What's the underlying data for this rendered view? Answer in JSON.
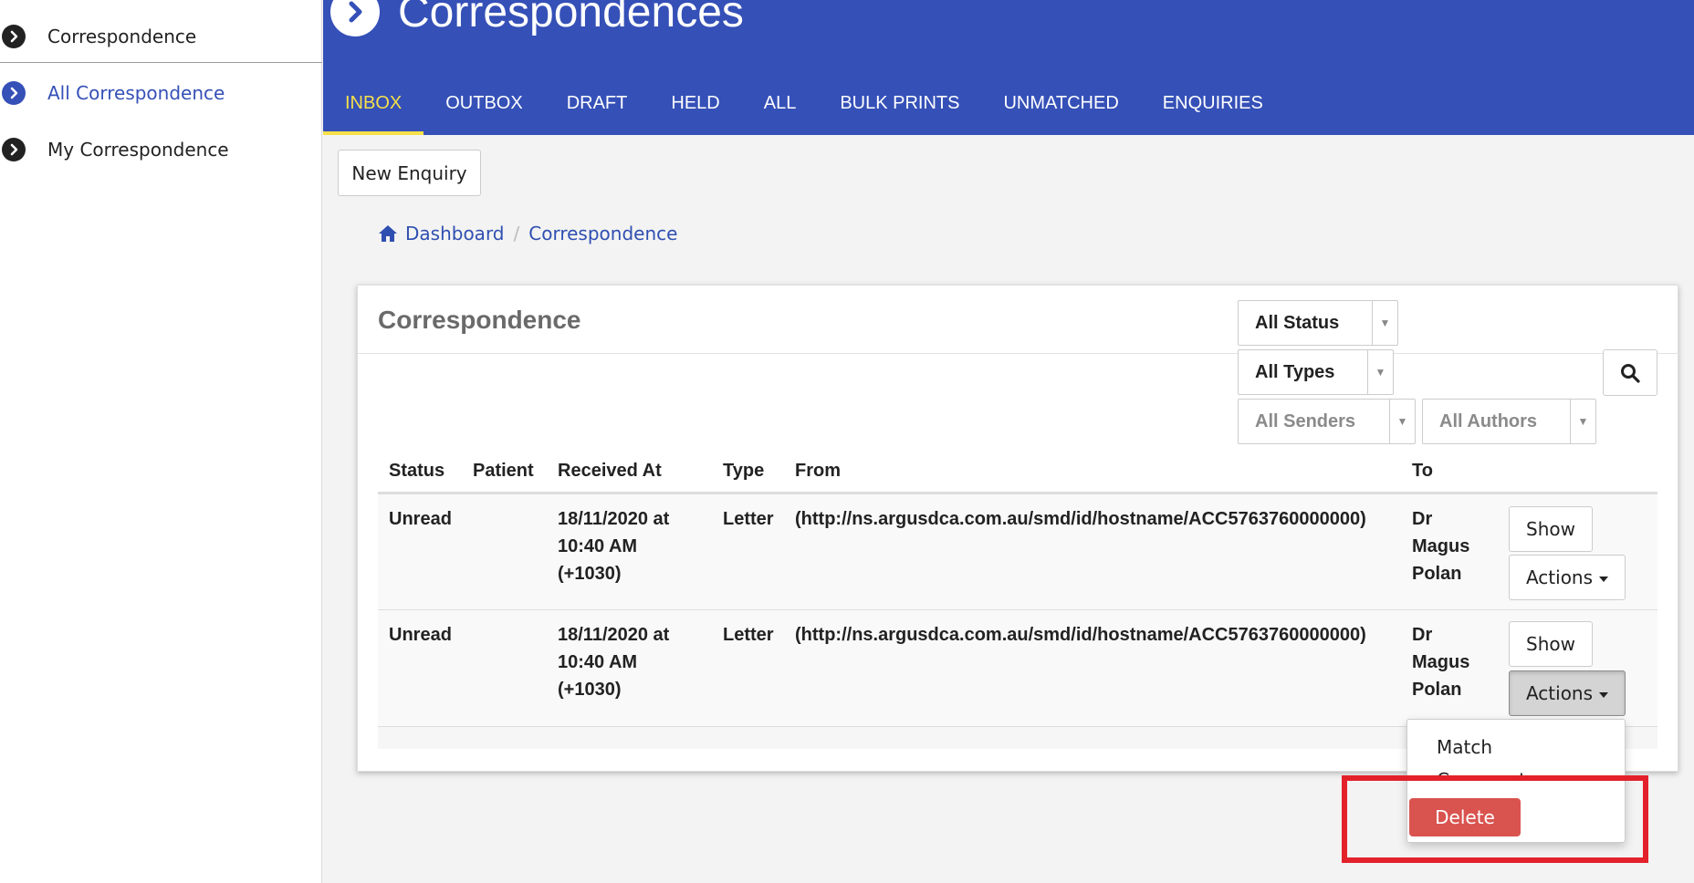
{
  "sidebar": {
    "items": [
      {
        "label": "Correspondence",
        "active": false
      },
      {
        "label": "All Correspondence",
        "active": true
      },
      {
        "label": "My Correspondence",
        "active": false
      }
    ]
  },
  "header": {
    "title": "Correspondences",
    "tabs": [
      "INBOX",
      "OUTBOX",
      "DRAFT",
      "HELD",
      "ALL",
      "BULK PRINTS",
      "UNMATCHED",
      "ENQUIRIES"
    ],
    "active_tab": "INBOX"
  },
  "toolbar": {
    "new_enquiry_label": "New Enquiry"
  },
  "breadcrumb": {
    "home": "Dashboard",
    "current": "Correspondence"
  },
  "panel": {
    "title": "Correspondence",
    "filters": {
      "status": "All Status",
      "types": "All Types",
      "senders": "All Senders",
      "authors": "All Authors"
    },
    "columns": [
      "Status",
      "Patient",
      "Received At",
      "Type",
      "From",
      "To"
    ],
    "rows": [
      {
        "status": "Unread",
        "patient": "",
        "received_line1": "18/11/2020 at",
        "received_line2": "10:40 AM",
        "received_line3": "(+1030)",
        "type": "Letter",
        "from": "(http://ns.argusdca.com.au/smd/id/hostname/ACC5763760000000)",
        "to_line1": "Dr",
        "to_line2": "Magus",
        "to_line3": "Polan",
        "show_label": "Show",
        "actions_label": "Actions"
      },
      {
        "status": "Unread",
        "patient": "",
        "received_line1": "18/11/2020 at",
        "received_line2": "10:40 AM",
        "received_line3": "(+1030)",
        "type": "Letter",
        "from": "(http://ns.argusdca.com.au/smd/id/hostname/ACC5763760000000)",
        "to_line1": "Dr",
        "to_line2": "Magus",
        "to_line3": "Polan",
        "show_label": "Show",
        "actions_label": "Actions"
      }
    ]
  },
  "actions_menu": {
    "items": [
      "Match",
      "Comment",
      "Delete"
    ]
  },
  "colors": {
    "header_bg": "#3550b7",
    "active_tab": "#f5e04a",
    "link": "#2f4fb0",
    "delete_bg": "#d9534f",
    "highlight": "#e3212b"
  }
}
